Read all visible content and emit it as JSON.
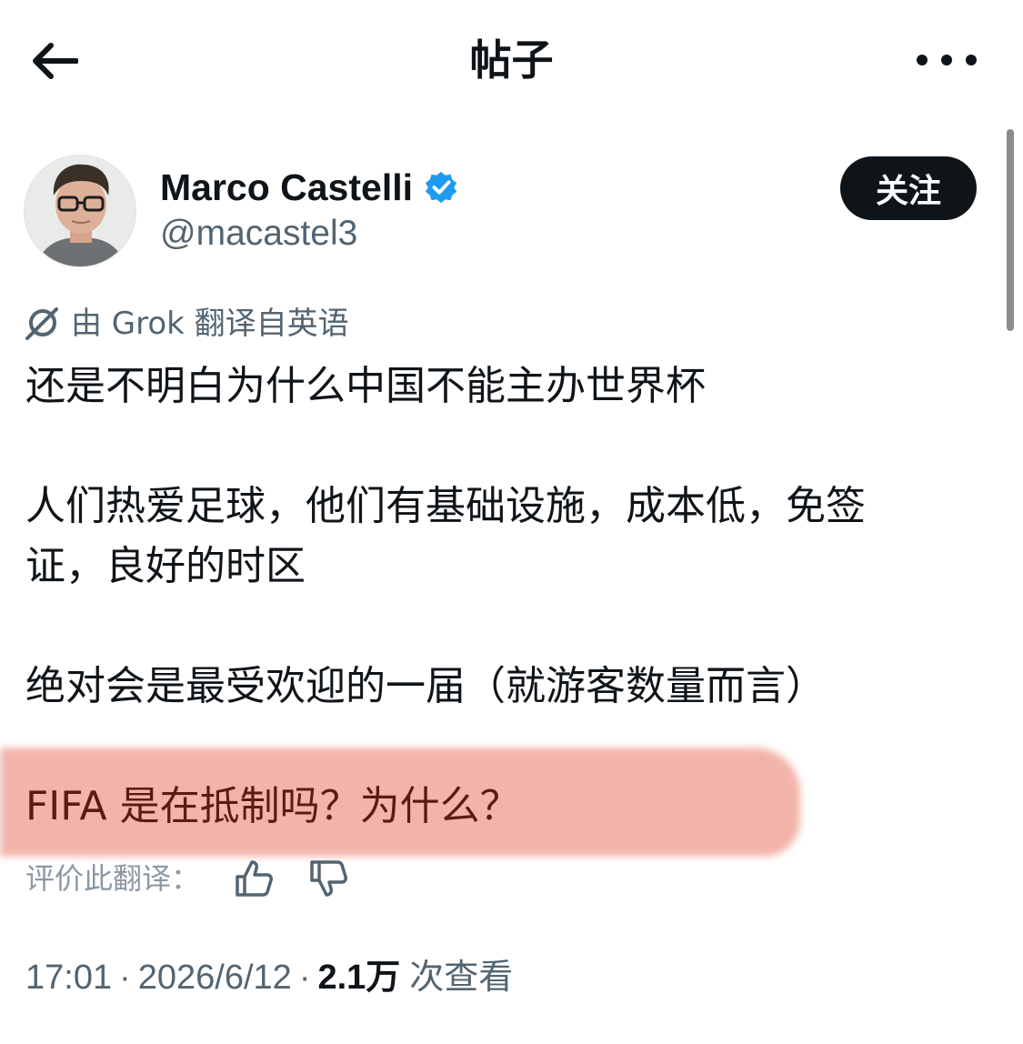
{
  "header": {
    "title": "帖子",
    "back_icon": "arrow-left-icon",
    "more_icon": "more-horizontal-icon"
  },
  "author": {
    "name": "Marco Castelli",
    "handle": "@macastel3",
    "verified": true,
    "verified_color": "#1d9bf0",
    "follow_label": "关注"
  },
  "translation": {
    "notice": "由 Grok 翻译自英语",
    "icon": "grok-icon"
  },
  "post": {
    "para1": "还是不明白为什么中国不能主办世界杯",
    "para2_line1": "人们热爱足球，他们有基础设施，成本低，免签",
    "para2_line2": "证，良好的时区",
    "para3": "绝对会是最受欢迎的一届（就游客数量而言）",
    "para4": "FIFA 是在抵制吗？为什么？",
    "highlight_color": "#f2b1a6"
  },
  "rate": {
    "label": "评价此翻译：",
    "up_icon": "thumbs-up-icon",
    "down_icon": "thumbs-down-icon"
  },
  "meta": {
    "time": "17:01",
    "date": "2026/6/12",
    "views_count": "2.1万",
    "views_label": "次查看",
    "separator": "·"
  }
}
